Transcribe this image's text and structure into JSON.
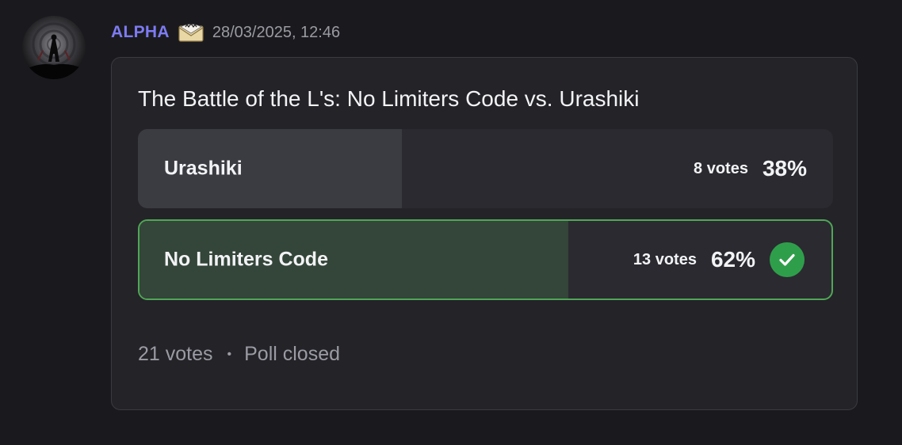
{
  "message": {
    "author": "ALPHA",
    "author_color": "#7d7bf3",
    "role_icon": "envelope-badge-icon",
    "timestamp": "28/03/2025, 12:46"
  },
  "poll": {
    "question": "The Battle of the L's: No Limiters Code vs. Urashiki",
    "answers": [
      {
        "label": "Urashiki",
        "votes_text": "8 votes",
        "percent_text": "38%",
        "fraction": 0.38,
        "winner": false
      },
      {
        "label": "No Limiters Code",
        "votes_text": "13 votes",
        "percent_text": "62%",
        "fraction": 0.62,
        "winner": true
      }
    ],
    "total_votes": "21 votes",
    "separator": "•",
    "status": "Poll closed",
    "winner_color": "#50a656"
  }
}
